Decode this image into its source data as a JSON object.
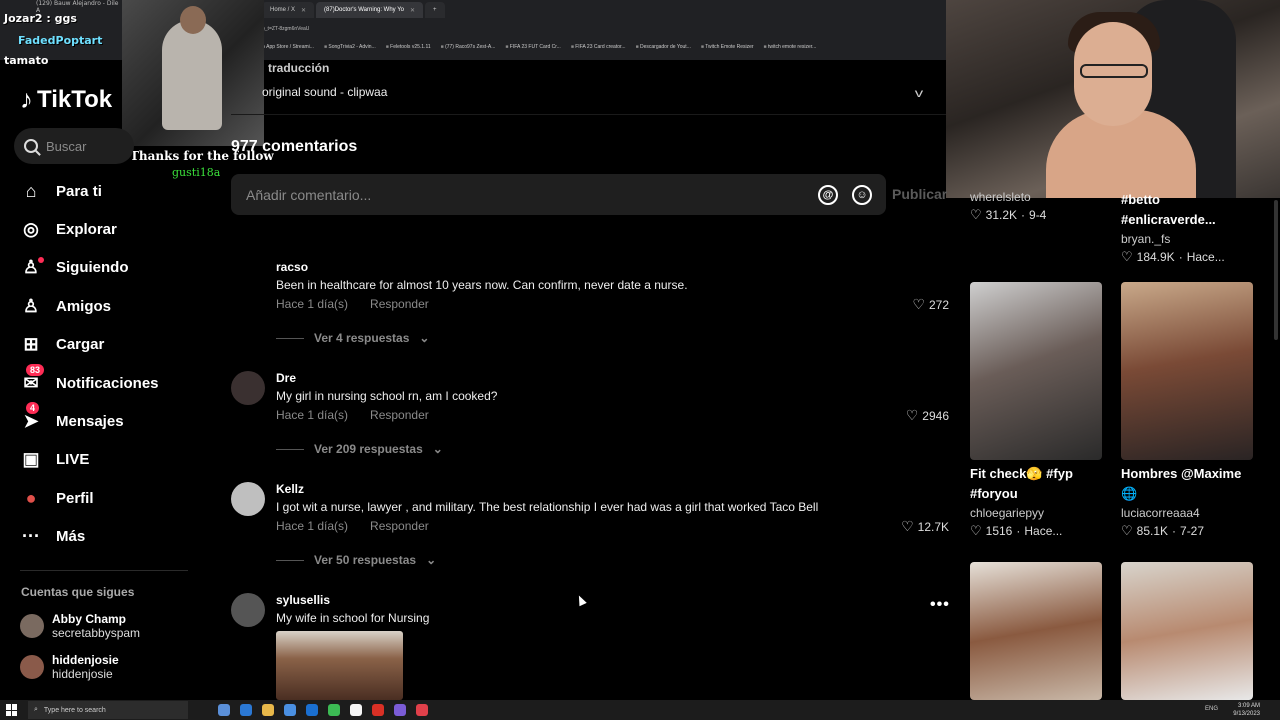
{
  "browser": {
    "tabs": [
      {
        "label": "Home / X",
        "active": false
      },
      {
        "label": "(87)Doctor's Warning: Why Yo",
        "active": true
      },
      {
        "label": "+",
        "active": false
      }
    ],
    "url": "b_t=ZT-8zgm6nVeaU",
    "bookmarks": [
      "App Store / Streami...",
      "SongTrivia2 - Advin...",
      "Feletools v25.1.11",
      "(77) Raco97s Zest-A...",
      "FIFA 23 FUT Card Cr...",
      "FIFA 23 Card creator...",
      "Descargador de Yout...",
      "Twitch Emote Resizer",
      "twitch emote resizer..."
    ]
  },
  "overlay": {
    "chat_top": "(129) Bauw Alejandro - Dile A",
    "chat_user1": "Jozar2 : ggs",
    "chat_user2": "FadedPoptart",
    "chat_user3": "tamato",
    "follow_text": "Thanks for the follow",
    "follower_name": "gusti18a"
  },
  "sidebar": {
    "logo": "TikTok",
    "search_placeholder": "Buscar",
    "items": [
      {
        "label": "Para ti",
        "icon": "home-icon",
        "glyph": "⌂"
      },
      {
        "label": "Explorar",
        "icon": "compass-icon",
        "glyph": "◎"
      },
      {
        "label": "Siguiendo",
        "icon": "following-icon",
        "glyph": "♙"
      },
      {
        "label": "Amigos",
        "icon": "friends-icon",
        "glyph": "♙"
      },
      {
        "label": "Cargar",
        "icon": "upload-icon",
        "glyph": "⊞"
      },
      {
        "label": "Notificaciones",
        "icon": "notifications-icon",
        "glyph": "✉",
        "badge": "83"
      },
      {
        "label": "Mensajes",
        "icon": "messages-icon",
        "glyph": "➤",
        "badge": "4"
      },
      {
        "label": "LIVE",
        "icon": "live-icon",
        "glyph": "▣"
      },
      {
        "label": "Perfil",
        "icon": "profile-icon",
        "glyph": "●"
      },
      {
        "label": "Más",
        "icon": "more-icon",
        "glyph": "···"
      }
    ],
    "following_title": "Cuentas que sigues",
    "accounts": [
      {
        "name": "Abby Champ",
        "handle": "secretabbyspam"
      },
      {
        "name": "hiddenjosie",
        "handle": "hiddenjosie"
      }
    ]
  },
  "video": {
    "translation": "traducción",
    "sound": "original sound - clipwaa"
  },
  "comments": {
    "title": "977 comentarios",
    "input_placeholder": "Añadir comentario...",
    "publish": "Publicar",
    "reply_label": "Responder",
    "items": [
      {
        "user": "racso",
        "text": "Been in healthcare for almost 10 years now. Can confirm, never date a nurse.",
        "time": "Hace 1 día(s)",
        "likes": "272",
        "replies": "Ver 4 respuestas"
      },
      {
        "user": "Dre",
        "text": "My girl in nursing school rn, am I cooked?",
        "time": "Hace 1 día(s)",
        "likes": "2946",
        "replies": "Ver 209 respuestas"
      },
      {
        "user": "Kellz",
        "text": "I got wit a nurse, lawyer , and military. The best relationship I ever had was a girl that worked Taco Bell",
        "time": "Hace 1 día(s)",
        "likes": "12.7K",
        "replies": "Ver 50 respuestas"
      },
      {
        "user": "sylusellis",
        "text": "My wife in school for Nursing"
      }
    ]
  },
  "related": [
    {
      "title": "",
      "user": "wherelsleto",
      "likes": "31.2K",
      "date": "9-4"
    },
    {
      "title": "#betto #enlicraverde...",
      "user": "bryan._fs",
      "likes": "184.9K",
      "date": "Hace..."
    },
    {
      "title": "Fit check🫣 #fyp #foryou",
      "user": "chloegariepyy",
      "likes": "1516",
      "date": "Hace..."
    },
    {
      "title": "Hombres @Maxime 🌐",
      "user": "luciacorreaaa4",
      "likes": "85.1K",
      "date": "7-27"
    }
  ],
  "taskbar": {
    "search": "Type here to search",
    "lang": "ENG",
    "time": "3:09 AM",
    "date": "9/13/2023"
  },
  "colors": {
    "accent": "#fe2c55",
    "follower": "#3be13b"
  }
}
